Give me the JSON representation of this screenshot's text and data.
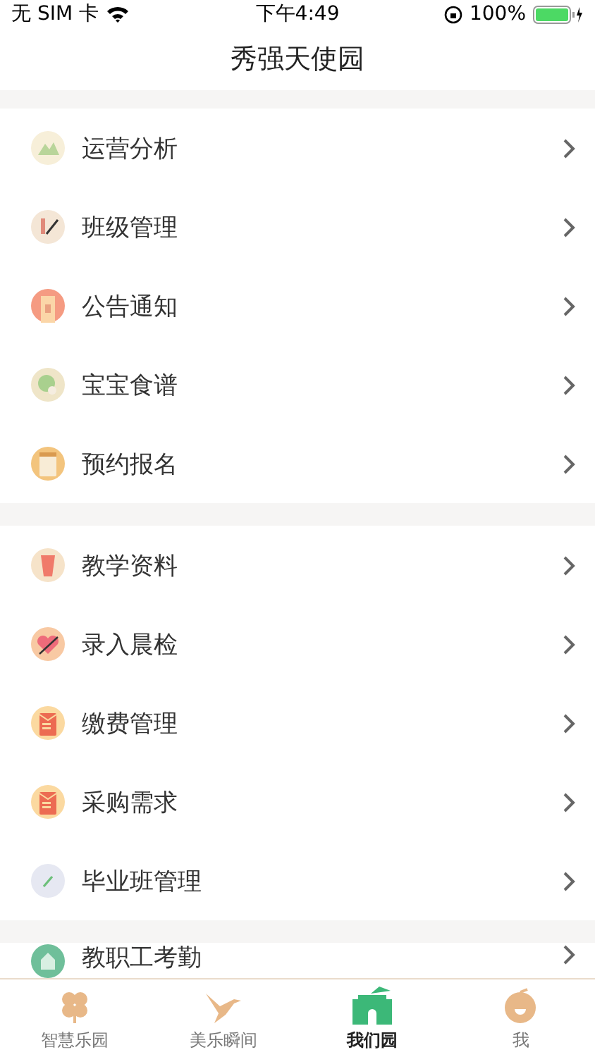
{
  "status_bar": {
    "carrier": "无 SIM 卡",
    "time": "下午4:49",
    "battery": "100%"
  },
  "nav": {
    "title": "秀强天使园"
  },
  "groups": [
    {
      "items": [
        {
          "label": "运营分析",
          "kind": "mountain",
          "color": "#f7efd9"
        },
        {
          "label": "班级管理",
          "kind": "brush",
          "color": "#f4e6d6"
        },
        {
          "label": "公告通知",
          "kind": "door",
          "color": "#f59b82"
        },
        {
          "label": "宝宝食谱",
          "kind": "leaf",
          "color": "#efe5c8"
        },
        {
          "label": "预约报名",
          "kind": "scroll",
          "color": "#f3c47d"
        }
      ]
    },
    {
      "items": [
        {
          "label": "教学资料",
          "kind": "lantern",
          "color": "#f6e3c9"
        },
        {
          "label": "录入晨检",
          "kind": "heart",
          "color": "#f8c9a3"
        },
        {
          "label": "缴费管理",
          "kind": "envelope",
          "color": "#fbd9a0"
        },
        {
          "label": "采购需求",
          "kind": "envelope",
          "color": "#fbd9a0"
        },
        {
          "label": "毕业班管理",
          "kind": "pencil",
          "color": "#e6e8f2"
        }
      ]
    },
    {
      "items": [
        {
          "label": "教职工考勤",
          "kind": "house",
          "color": "#6fbf9a"
        }
      ]
    }
  ],
  "tabs": [
    {
      "label": "智慧乐园",
      "kind": "clover",
      "selected": false
    },
    {
      "label": "美乐瞬间",
      "kind": "bird",
      "selected": false
    },
    {
      "label": "我们园",
      "kind": "gate",
      "selected": true
    },
    {
      "label": "我",
      "kind": "face",
      "selected": false
    }
  ]
}
